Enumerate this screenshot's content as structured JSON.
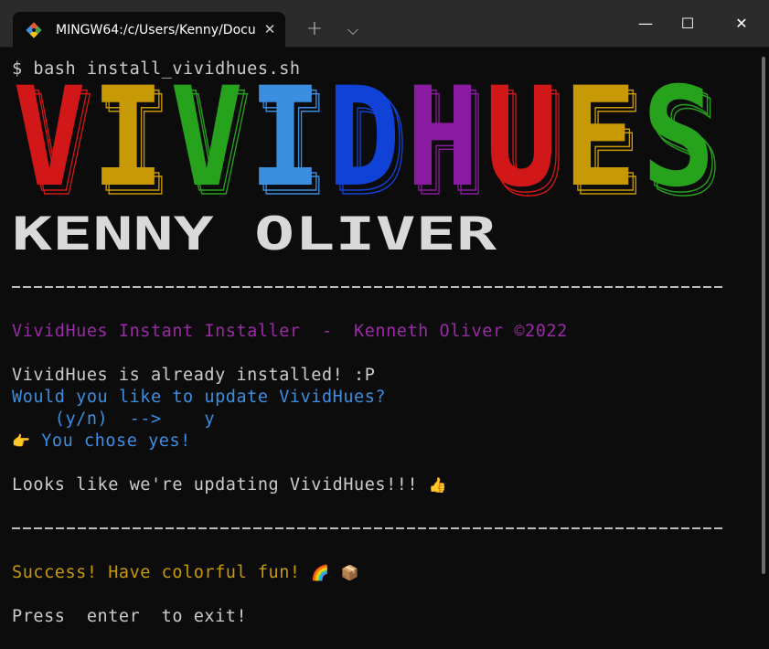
{
  "window": {
    "tab_title": "MINGW64:/c/Users/Kenny/Docu",
    "tab_close": "✕",
    "new_tab": "+",
    "dropdown": "⌵",
    "minimize": "—",
    "maximize": "☐",
    "close": "✕"
  },
  "terminal": {
    "command_line": "$ bash install_vividhues.sh",
    "banner_title": "VIVIDHUES",
    "banner_letters": [
      {
        "char": "V",
        "color": "#d11717"
      },
      {
        "char": "I",
        "color": "#c79a05"
      },
      {
        "char": "V",
        "color": "#27a21d"
      },
      {
        "char": "I",
        "color": "#3b8ee0"
      },
      {
        "char": "D",
        "color": "#1142d8"
      },
      {
        "char": "H",
        "color": "#8a1aa0"
      },
      {
        "char": "U",
        "color": "#d11717"
      },
      {
        "char": "E",
        "color": "#c79a05"
      },
      {
        "char": "S",
        "color": "#27a21d"
      }
    ],
    "author_banner": "KENNY OLIVER",
    "header_line": "VividHues Instant Installer  -  Kenneth Oliver ©2022",
    "installed_line": "VividHues is already installed! :P",
    "update_question": "Would you like to update VividHues?",
    "prompt_line": "    (y/n)  -->    y",
    "choice_line": "You chose yes!",
    "choice_emoji": "👉",
    "updating_line": "Looks like we're updating VividHues!!!",
    "updating_emoji": "👍",
    "success_line": "Success! Have colorful fun!",
    "success_emoji_1": "🌈",
    "success_emoji_2": "📦",
    "exit_line": "Press  enter  to exit!"
  },
  "colors": {
    "background": "#0c0c0c",
    "titlebar": "#2b2b2b",
    "text": "#cccccc",
    "purple": "#9a2aa6",
    "blue": "#3b8ee0",
    "gold": "#c79a05"
  }
}
